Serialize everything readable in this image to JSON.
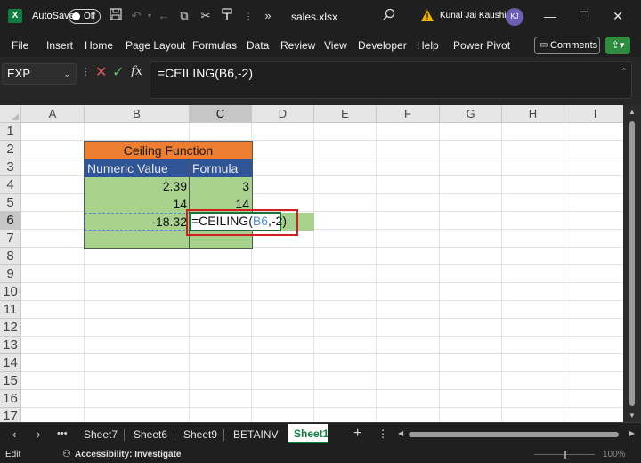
{
  "titlebar": {
    "autosave_label": "AutoSave",
    "autosave_state": "Off",
    "filename": "sales.xlsx",
    "user_name": "Kunal Jai Kaushik",
    "user_initials": "KJ"
  },
  "menu": [
    "File",
    "Insert",
    "Home",
    "Page Layout",
    "Formulas",
    "Data",
    "Review",
    "View",
    "Developer",
    "Help",
    "Power Pivot"
  ],
  "comments_label": "Comments",
  "formula_bar": {
    "name_box": "EXP",
    "formula": "=CEILING(B6,-2)"
  },
  "columns": [
    "A",
    "B",
    "C",
    "D",
    "E",
    "F",
    "G",
    "H",
    "I"
  ],
  "active_column": "C",
  "rows": [
    "1",
    "2",
    "3",
    "4",
    "5",
    "6",
    "7",
    "8",
    "9",
    "10",
    "11",
    "12",
    "13",
    "14",
    "15",
    "16",
    "17"
  ],
  "active_row": "6",
  "table": {
    "title": "Ceiling Function",
    "headers": [
      "Numeric Value",
      "Formula"
    ],
    "rows": [
      {
        "value": "2.39",
        "result": "3"
      },
      {
        "value": "14",
        "result": "14"
      },
      {
        "value": "-18.32"
      }
    ]
  },
  "editing_cell": {
    "prefix": "=CEILING(",
    "ref": "B6",
    "suffix": ",-2)"
  },
  "sheet_tabs": [
    "Sheet7",
    "Sheet6",
    "Sheet9",
    "BETAINV",
    "Sheet1"
  ],
  "active_sheet": "Sheet1",
  "statusbar": {
    "mode": "Edit",
    "accessibility": "Accessibility: Investigate",
    "zoom": "100%"
  },
  "colors": {
    "title_fill": "#ed7d31",
    "header_fill": "#2f5597",
    "data_fill": "#a9d18e",
    "excel_green": "#107c41",
    "highlight_box": "#d21f1f"
  },
  "icons": [
    "excel-logo-icon",
    "save-icon",
    "undo-icon",
    "redo-icon",
    "back-icon",
    "copy-icon",
    "cut-icon",
    "format-painter-icon",
    "more-icon",
    "search-icon",
    "warning-icon",
    "minimize-icon",
    "maximize-icon",
    "close-icon",
    "comment-icon",
    "share-icon",
    "cancel-icon",
    "enter-icon",
    "fx-icon",
    "accessibility-icon"
  ]
}
